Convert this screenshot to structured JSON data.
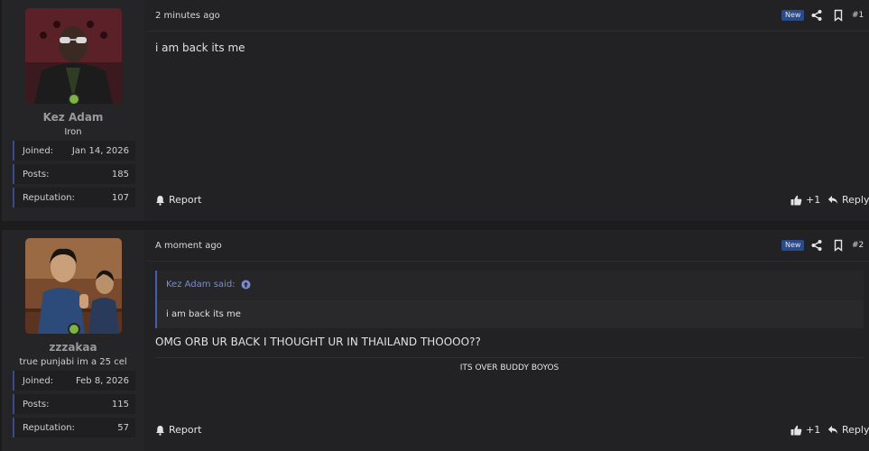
{
  "posts": [
    {
      "user": {
        "name": "Kez Adam",
        "title": "Iron"
      },
      "stats": [
        {
          "label": "Joined:",
          "value": "Jan 14, 2026"
        },
        {
          "label": "Posts:",
          "value": "185"
        },
        {
          "label": "Reputation:",
          "value": "107"
        }
      ],
      "time": "2 minutes ago",
      "badge": "New",
      "number": "#1",
      "body": "i am back its me",
      "report": "Report",
      "plus_one": "+1",
      "reply": "Reply"
    },
    {
      "user": {
        "name": "zzzakaa",
        "title": "true punjabi im a 25 cel"
      },
      "stats": [
        {
          "label": "Joined:",
          "value": "Feb 8, 2026"
        },
        {
          "label": "Posts:",
          "value": "115"
        },
        {
          "label": "Reputation:",
          "value": "57"
        }
      ],
      "time": "A moment ago",
      "badge": "New",
      "number": "#2",
      "quote": {
        "author": "Kez Adam said:",
        "text": "i am back its me"
      },
      "body": "OMG ORB UR BACK I THOUGHT UR IN THAILAND THOOOO??",
      "centered": "ITS OVER BUDDY BOYOS",
      "report": "Report",
      "plus_one": "+1",
      "reply": "Reply"
    }
  ],
  "colors": {
    "accent": "#4a5ca8",
    "online": "#7cb342",
    "badge": "#2a4a8a"
  }
}
